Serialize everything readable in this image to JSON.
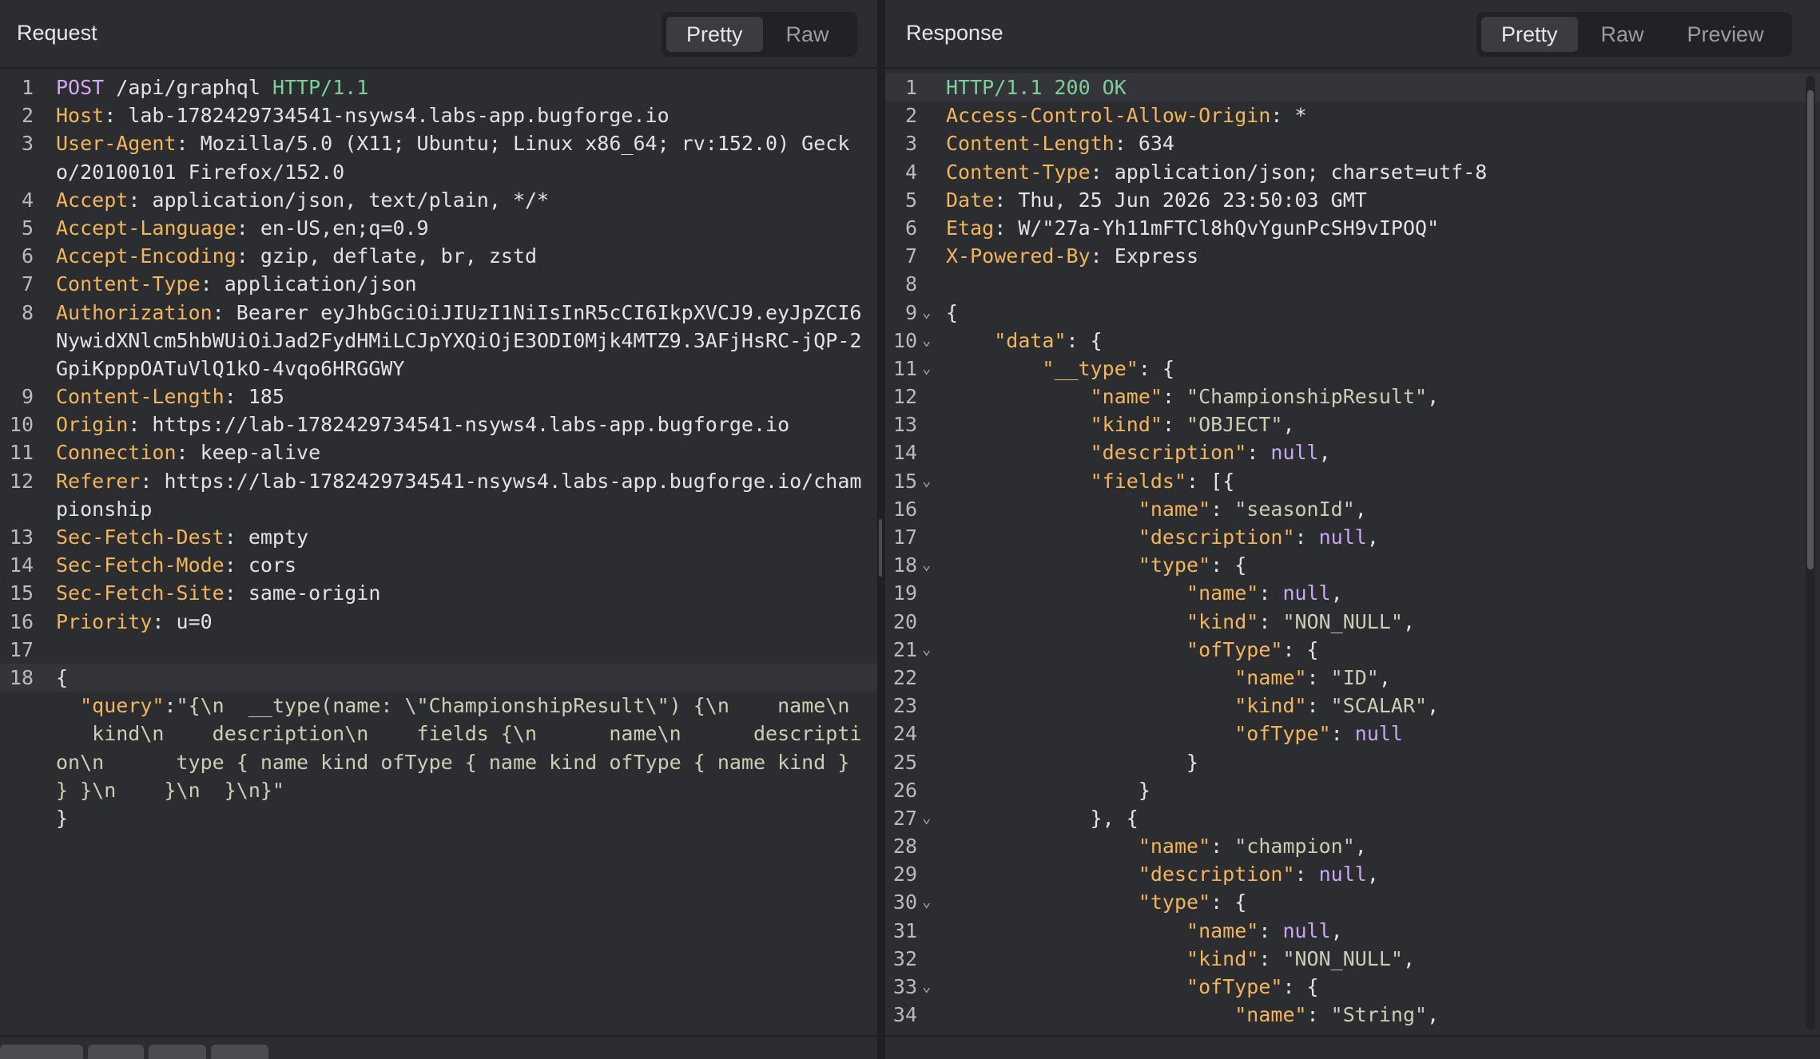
{
  "request": {
    "title": "Request",
    "tabs": [
      "Pretty",
      "Raw"
    ],
    "active_tab": "Pretty",
    "lines": [
      {
        "n": "1",
        "parts": [
          {
            "t": "POST",
            "c": "m"
          },
          {
            "t": " /api/graphql "
          },
          {
            "t": "HTTP/1.1",
            "c": "g"
          }
        ]
      },
      {
        "n": "2",
        "parts": [
          {
            "t": "Host",
            "c": "k"
          },
          {
            "t": ": lab-1782429734541-nsyws4.labs-app.bugforge.io"
          }
        ]
      },
      {
        "n": "3",
        "parts": [
          {
            "t": "User-Agent",
            "c": "k"
          },
          {
            "t": ": Mozilla/5.0 (X11; Ubuntu; Linux x86_64; rv:152.0) Geck"
          }
        ]
      },
      {
        "n": "",
        "parts": [
          {
            "t": "o/20100101 Firefox/152.0"
          }
        ]
      },
      {
        "n": "4",
        "parts": [
          {
            "t": "Accept",
            "c": "k"
          },
          {
            "t": ": application/json, text/plain, */*"
          }
        ]
      },
      {
        "n": "5",
        "parts": [
          {
            "t": "Accept-Language",
            "c": "k"
          },
          {
            "t": ": en-US,en;q=0.9"
          }
        ]
      },
      {
        "n": "6",
        "parts": [
          {
            "t": "Accept-Encoding",
            "c": "k"
          },
          {
            "t": ": gzip, deflate, br, zstd"
          }
        ]
      },
      {
        "n": "7",
        "parts": [
          {
            "t": "Content-Type",
            "c": "k"
          },
          {
            "t": ": application/json"
          }
        ]
      },
      {
        "n": "8",
        "parts": [
          {
            "t": "Authorization",
            "c": "k"
          },
          {
            "t": ": Bearer eyJhbGciOiJIUzI1NiIsInR5cCI6IkpXVCJ9.eyJpZCI6"
          }
        ]
      },
      {
        "n": "",
        "parts": [
          {
            "t": "NywidXNlcm5hbWUiOiJad2FydHMiLCJpYXQiOjE3ODI0Mjk4MTZ9.3AFjHsRC-jQP-2"
          }
        ]
      },
      {
        "n": "",
        "parts": [
          {
            "t": "GpiKpppOATuVlQ1kO-4vqo6HRGGWY"
          }
        ]
      },
      {
        "n": "9",
        "parts": [
          {
            "t": "Content-Length",
            "c": "k"
          },
          {
            "t": ": 185"
          }
        ]
      },
      {
        "n": "10",
        "parts": [
          {
            "t": "Origin",
            "c": "k"
          },
          {
            "t": ": https://lab-1782429734541-nsyws4.labs-app.bugforge.io"
          }
        ]
      },
      {
        "n": "11",
        "parts": [
          {
            "t": "Connection",
            "c": "k"
          },
          {
            "t": ": keep-alive"
          }
        ]
      },
      {
        "n": "12",
        "parts": [
          {
            "t": "Referer",
            "c": "k"
          },
          {
            "t": ": https://lab-1782429734541-nsyws4.labs-app.bugforge.io/cham"
          }
        ]
      },
      {
        "n": "",
        "parts": [
          {
            "t": "pionship"
          }
        ]
      },
      {
        "n": "13",
        "parts": [
          {
            "t": "Sec-Fetch-Dest",
            "c": "k"
          },
          {
            "t": ": empty"
          }
        ]
      },
      {
        "n": "14",
        "parts": [
          {
            "t": "Sec-Fetch-Mode",
            "c": "k"
          },
          {
            "t": ": cors"
          }
        ]
      },
      {
        "n": "15",
        "parts": [
          {
            "t": "Sec-Fetch-Site",
            "c": "k"
          },
          {
            "t": ": same-origin"
          }
        ]
      },
      {
        "n": "16",
        "parts": [
          {
            "t": "Priority",
            "c": "k"
          },
          {
            "t": ": u=0"
          }
        ]
      },
      {
        "n": "17",
        "parts": [
          {
            "t": ""
          }
        ]
      },
      {
        "n": "18",
        "hl": true,
        "parts": [
          {
            "t": "{"
          }
        ]
      },
      {
        "n": "",
        "parts": [
          {
            "t": "  "
          },
          {
            "t": "\"query\"",
            "c": "k"
          },
          {
            "t": ":"
          },
          {
            "t": "\"{\\n  __type(name: \\\"ChampionshipResult\\\") {\\n    name\\n",
            "c": "s"
          }
        ]
      },
      {
        "n": "",
        "parts": [
          {
            "t": "   kind\\n    description\\n    fields {\\n      name\\n      descripti",
            "c": "s"
          }
        ]
      },
      {
        "n": "",
        "parts": [
          {
            "t": "on\\n      type { name kind ofType { name kind ofType { name kind }",
            "c": "s"
          }
        ]
      },
      {
        "n": "",
        "parts": [
          {
            "t": "} }\\n    }\\n  }\\n}\"",
            "c": "s"
          }
        ]
      },
      {
        "n": "",
        "parts": [
          {
            "t": "}"
          }
        ]
      }
    ]
  },
  "response": {
    "title": "Response",
    "tabs": [
      "Pretty",
      "Raw",
      "Preview"
    ],
    "active_tab": "Pretty",
    "lines": [
      {
        "n": "1",
        "hl": true,
        "parts": [
          {
            "t": "HTTP/1.1 200 OK",
            "c": "g"
          }
        ]
      },
      {
        "n": "2",
        "parts": [
          {
            "t": "Access-Control-Allow-Origin",
            "c": "k"
          },
          {
            "t": ": *"
          }
        ]
      },
      {
        "n": "3",
        "parts": [
          {
            "t": "Content-Length",
            "c": "k"
          },
          {
            "t": ": 634"
          }
        ]
      },
      {
        "n": "4",
        "parts": [
          {
            "t": "Content-Type",
            "c": "k"
          },
          {
            "t": ": application/json; charset=utf-8"
          }
        ]
      },
      {
        "n": "5",
        "parts": [
          {
            "t": "Date",
            "c": "k"
          },
          {
            "t": ": Thu, 25 Jun 2026 23:50:03 GMT"
          }
        ]
      },
      {
        "n": "6",
        "parts": [
          {
            "t": "Etag",
            "c": "k"
          },
          {
            "t": ": W/\"27a-Yh11mFTCl8hQvYgunPcSH9vIPOQ\""
          }
        ]
      },
      {
        "n": "7",
        "parts": [
          {
            "t": "X-Powered-By",
            "c": "k"
          },
          {
            "t": ": Express"
          }
        ]
      },
      {
        "n": "8",
        "parts": [
          {
            "t": ""
          }
        ]
      },
      {
        "n": "9",
        "fold": true,
        "parts": [
          {
            "t": "{"
          }
        ]
      },
      {
        "n": "10",
        "fold": true,
        "parts": [
          {
            "t": "    "
          },
          {
            "t": "\"data\"",
            "c": "k"
          },
          {
            "t": ": {"
          }
        ]
      },
      {
        "n": "11",
        "fold": true,
        "parts": [
          {
            "t": "        "
          },
          {
            "t": "\"__type\"",
            "c": "k"
          },
          {
            "t": ": {"
          }
        ]
      },
      {
        "n": "12",
        "parts": [
          {
            "t": "            "
          },
          {
            "t": "\"name\"",
            "c": "k"
          },
          {
            "t": ": "
          },
          {
            "t": "\"ChampionshipResult\"",
            "c": "s"
          },
          {
            "t": ","
          }
        ]
      },
      {
        "n": "13",
        "parts": [
          {
            "t": "            "
          },
          {
            "t": "\"kind\"",
            "c": "k"
          },
          {
            "t": ": "
          },
          {
            "t": "\"OBJECT\"",
            "c": "s"
          },
          {
            "t": ","
          }
        ]
      },
      {
        "n": "14",
        "parts": [
          {
            "t": "            "
          },
          {
            "t": "\"description\"",
            "c": "k"
          },
          {
            "t": ": "
          },
          {
            "t": "null",
            "c": "n"
          },
          {
            "t": ","
          }
        ]
      },
      {
        "n": "15",
        "fold": true,
        "parts": [
          {
            "t": "            "
          },
          {
            "t": "\"fields\"",
            "c": "k"
          },
          {
            "t": ": [{"
          }
        ]
      },
      {
        "n": "16",
        "parts": [
          {
            "t": "                "
          },
          {
            "t": "\"name\"",
            "c": "k"
          },
          {
            "t": ": "
          },
          {
            "t": "\"seasonId\"",
            "c": "s"
          },
          {
            "t": ","
          }
        ]
      },
      {
        "n": "17",
        "parts": [
          {
            "t": "                "
          },
          {
            "t": "\"description\"",
            "c": "k"
          },
          {
            "t": ": "
          },
          {
            "t": "null",
            "c": "n"
          },
          {
            "t": ","
          }
        ]
      },
      {
        "n": "18",
        "fold": true,
        "parts": [
          {
            "t": "                "
          },
          {
            "t": "\"type\"",
            "c": "k"
          },
          {
            "t": ": {"
          }
        ]
      },
      {
        "n": "19",
        "parts": [
          {
            "t": "                    "
          },
          {
            "t": "\"name\"",
            "c": "k"
          },
          {
            "t": ": "
          },
          {
            "t": "null",
            "c": "n"
          },
          {
            "t": ","
          }
        ]
      },
      {
        "n": "20",
        "parts": [
          {
            "t": "                    "
          },
          {
            "t": "\"kind\"",
            "c": "k"
          },
          {
            "t": ": "
          },
          {
            "t": "\"NON_NULL\"",
            "c": "s"
          },
          {
            "t": ","
          }
        ]
      },
      {
        "n": "21",
        "fold": true,
        "parts": [
          {
            "t": "                    "
          },
          {
            "t": "\"ofType\"",
            "c": "k"
          },
          {
            "t": ": {"
          }
        ]
      },
      {
        "n": "22",
        "parts": [
          {
            "t": "                        "
          },
          {
            "t": "\"name\"",
            "c": "k"
          },
          {
            "t": ": "
          },
          {
            "t": "\"ID\"",
            "c": "s"
          },
          {
            "t": ","
          }
        ]
      },
      {
        "n": "23",
        "parts": [
          {
            "t": "                        "
          },
          {
            "t": "\"kind\"",
            "c": "k"
          },
          {
            "t": ": "
          },
          {
            "t": "\"SCALAR\"",
            "c": "s"
          },
          {
            "t": ","
          }
        ]
      },
      {
        "n": "24",
        "parts": [
          {
            "t": "                        "
          },
          {
            "t": "\"ofType\"",
            "c": "k"
          },
          {
            "t": ": "
          },
          {
            "t": "null",
            "c": "n"
          }
        ]
      },
      {
        "n": "25",
        "parts": [
          {
            "t": "                    }"
          }
        ]
      },
      {
        "n": "26",
        "parts": [
          {
            "t": "                }"
          }
        ]
      },
      {
        "n": "27",
        "fold": true,
        "parts": [
          {
            "t": "            }, {"
          }
        ]
      },
      {
        "n": "28",
        "parts": [
          {
            "t": "                "
          },
          {
            "t": "\"name\"",
            "c": "k"
          },
          {
            "t": ": "
          },
          {
            "t": "\"champion\"",
            "c": "s"
          },
          {
            "t": ","
          }
        ]
      },
      {
        "n": "29",
        "parts": [
          {
            "t": "                "
          },
          {
            "t": "\"description\"",
            "c": "k"
          },
          {
            "t": ": "
          },
          {
            "t": "null",
            "c": "n"
          },
          {
            "t": ","
          }
        ]
      },
      {
        "n": "30",
        "fold": true,
        "parts": [
          {
            "t": "                "
          },
          {
            "t": "\"type\"",
            "c": "k"
          },
          {
            "t": ": {"
          }
        ]
      },
      {
        "n": "31",
        "parts": [
          {
            "t": "                    "
          },
          {
            "t": "\"name\"",
            "c": "k"
          },
          {
            "t": ": "
          },
          {
            "t": "null",
            "c": "n"
          },
          {
            "t": ","
          }
        ]
      },
      {
        "n": "32",
        "parts": [
          {
            "t": "                    "
          },
          {
            "t": "\"kind\"",
            "c": "k"
          },
          {
            "t": ": "
          },
          {
            "t": "\"NON_NULL\"",
            "c": "s"
          },
          {
            "t": ","
          }
        ]
      },
      {
        "n": "33",
        "fold": true,
        "parts": [
          {
            "t": "                    "
          },
          {
            "t": "\"ofType\"",
            "c": "k"
          },
          {
            "t": ": {"
          }
        ]
      },
      {
        "n": "34",
        "parts": [
          {
            "t": "                        "
          },
          {
            "t": "\"name\"",
            "c": "k"
          },
          {
            "t": ": "
          },
          {
            "t": "\"String\"",
            "c": "s"
          },
          {
            "t": ","
          }
        ]
      }
    ]
  },
  "fold_icon": "chevron-down-icon"
}
